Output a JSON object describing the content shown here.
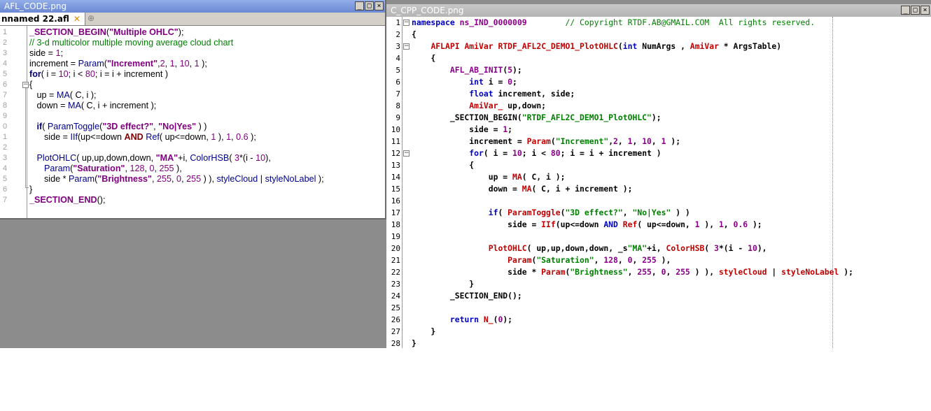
{
  "left_window": {
    "title": "AFL_CODE.png",
    "tab_label": "nnamed 22.afl",
    "tab_close": "✕",
    "tab_add": "⊕",
    "buttons": {
      "min": "_",
      "max": "□",
      "close": "×"
    },
    "lines": [
      {
        "n": "1",
        "html": "<span class='str'>_SECTION_BEGIN</span>(<span class='str'>\"Multiple OHLC\"</span>);"
      },
      {
        "n": "2",
        "html": "<span class='cm'>// 3-d multicolor multiple moving average cloud chart</span>"
      },
      {
        "n": "3",
        "html": "side = <span class='num'>1</span>;"
      },
      {
        "n": "4",
        "html": "increment = <span class='fn'>Param</span>(<span class='str'>\"Increment\"</span>,<span class='num'>2</span>, <span class='num'>1</span>, <span class='num'>10</span>, <span class='num'>1</span> );"
      },
      {
        "n": "5",
        "html": "<span class='k'>for</span>( i = <span class='num'>10</span>; i &lt; <span class='num'>80</span>; i = i + increment )"
      },
      {
        "n": "6",
        "html": "{"
      },
      {
        "n": "7",
        "html": "   up = <span class='fn'>MA</span>( C, i );"
      },
      {
        "n": "8",
        "html": "   down = <span class='fn'>MA</span>( C, i + increment );"
      },
      {
        "n": "9",
        "html": ""
      },
      {
        "n": "0",
        "html": "   <span class='k'>if</span>( <span class='fn'>ParamToggle</span>(<span class='str'>\"3D effect?\"</span>, <span class='str'>\"No|Yes\"</span> ) )"
      },
      {
        "n": "1",
        "html": "      side = <span class='fn'>IIf</span>(up&lt;=down <span class='k' style='color:#800000'>AND</span> <span class='fn'>Ref</span>( up&lt;=down, <span class='num'>1</span> ), <span class='num'>1</span>, <span class='num'>0.6</span> );"
      },
      {
        "n": "2",
        "html": ""
      },
      {
        "n": "3",
        "html": "   <span class='fn'>PlotOHLC</span>( up,up,down,down, <span class='str'>\"MA\"</span>+i, <span class='fn'>ColorHSB</span>( <span class='num'>3</span>*(i - <span class='num'>10</span>),"
      },
      {
        "n": "4",
        "html": "      <span class='fn'>Param</span>(<span class='str'>\"Saturation\"</span>, <span class='num'>128</span>, <span class='num'>0</span>, <span class='num'>255</span> ),"
      },
      {
        "n": "5",
        "html": "      side * <span class='fn'>Param</span>(<span class='str'>\"Brightness\"</span>, <span class='num'>255</span>, <span class='num'>0</span>, <span class='num'>255</span> ) ), <span class='fn'>styleCloud</span> | <span class='fn'>styleNoLabel</span> );"
      },
      {
        "n": "6",
        "html": "}"
      },
      {
        "n": "7",
        "html": "<span class='str'>_SECTION_END</span>();"
      }
    ]
  },
  "right_window": {
    "title": "C_CPP_CODE.png",
    "buttons": {
      "min": "_",
      "max": "□",
      "close": "×"
    },
    "lines": [
      {
        "n": "1",
        "html": "<span class='blu'>namespace</span> <span class='pur'>ns_IND_0000009</span>        <span class='grn' style='font-weight:normal'>// Copyright RTDF.AB@GMAIL.COM  All rights reserved.</span>"
      },
      {
        "n": "2",
        "html": "{"
      },
      {
        "n": "3",
        "html": "    <span class='red'>AFLAPI</span> <span class='red'>AmiVar</span> <span class='red'>RTDF_AFL2C_DEMO1_PlotOHLC</span>(<span class='blu'>int</span> NumArgs , <span class='red'>AmiVar</span> * ArgsTable)"
      },
      {
        "n": "4",
        "html": "    {"
      },
      {
        "n": "5",
        "html": "        <span class='pur'>AFL_AB_INIT</span>(<span class='pur'>5</span>);"
      },
      {
        "n": "6",
        "html": "            <span class='blu'>int</span> i = <span class='pur'>0</span>;"
      },
      {
        "n": "7",
        "html": "            <span class='blu'>float</span> increment, side;"
      },
      {
        "n": "8",
        "html": "            <span class='red'>AmiVar_</span> up,down;"
      },
      {
        "n": "9",
        "html": "        _SECTION_BEGIN(<span class='grn'>\"RTDF_AFL2C_DEMO1_PlotOHLC\"</span>);"
      },
      {
        "n": "10",
        "html": "            side = <span class='pur'>1</span>;"
      },
      {
        "n": "11",
        "html": "            increment = <span class='red'>Param</span>(<span class='grn'>\"Increment\"</span>,<span class='pur'>2</span>, <span class='pur'>1</span>, <span class='pur'>10</span>, <span class='pur'>1</span> );"
      },
      {
        "n": "12",
        "html": "            <span class='blu'>for</span>( i = <span class='pur'>10</span>; i &lt; <span class='pur'>80</span>; i = i + increment )"
      },
      {
        "n": "13",
        "html": "            {"
      },
      {
        "n": "14",
        "html": "                up = <span class='red'>MA</span>( C, i );"
      },
      {
        "n": "15",
        "html": "                down = <span class='red'>MA</span>( C, i + increment );"
      },
      {
        "n": "16",
        "html": ""
      },
      {
        "n": "17",
        "html": "                <span class='blu'>if</span>( <span class='red'>ParamToggle</span>(<span class='grn'>\"3D effect?\"</span>, <span class='grn'>\"No|Yes\"</span> ) )"
      },
      {
        "n": "18",
        "html": "                    side = <span class='red'>IIf</span>(up&lt;=down <span class='blu'>AND</span> <span class='red'>Ref</span>( up&lt;=down, <span class='pur'>1</span> ), <span class='pur'>1</span>, <span class='pur'>0.6</span> );"
      },
      {
        "n": "19",
        "html": ""
      },
      {
        "n": "20",
        "html": "                <span class='red'>PlotOHLC</span>( up,up,down,down, _s<span class='grn'>\"MA\"</span>+i, <span class='red'>ColorHSB</span>( <span class='pur'>3</span>*(i - <span class='pur'>10</span>),"
      },
      {
        "n": "21",
        "html": "                    <span class='red'>Param</span>(<span class='grn'>\"Saturation\"</span>, <span class='pur'>128</span>, <span class='pur'>0</span>, <span class='pur'>255</span> ),"
      },
      {
        "n": "22",
        "html": "                    side * <span class='red'>Param</span>(<span class='grn'>\"Brightness\"</span>, <span class='pur'>255</span>, <span class='pur'>0</span>, <span class='pur'>255</span> ) ), <span class='red'>styleCloud</span> | <span class='red'>styleNoLabel</span> );"
      },
      {
        "n": "23",
        "html": "            }"
      },
      {
        "n": "24",
        "html": "        _SECTION_END();"
      },
      {
        "n": "25",
        "html": ""
      },
      {
        "n": "26",
        "html": "        <span class='blu'>return</span> <span class='red'>N_</span>(<span class='pur'>0</span>);"
      },
      {
        "n": "27",
        "html": "    }"
      },
      {
        "n": "28",
        "html": "}"
      }
    ]
  }
}
